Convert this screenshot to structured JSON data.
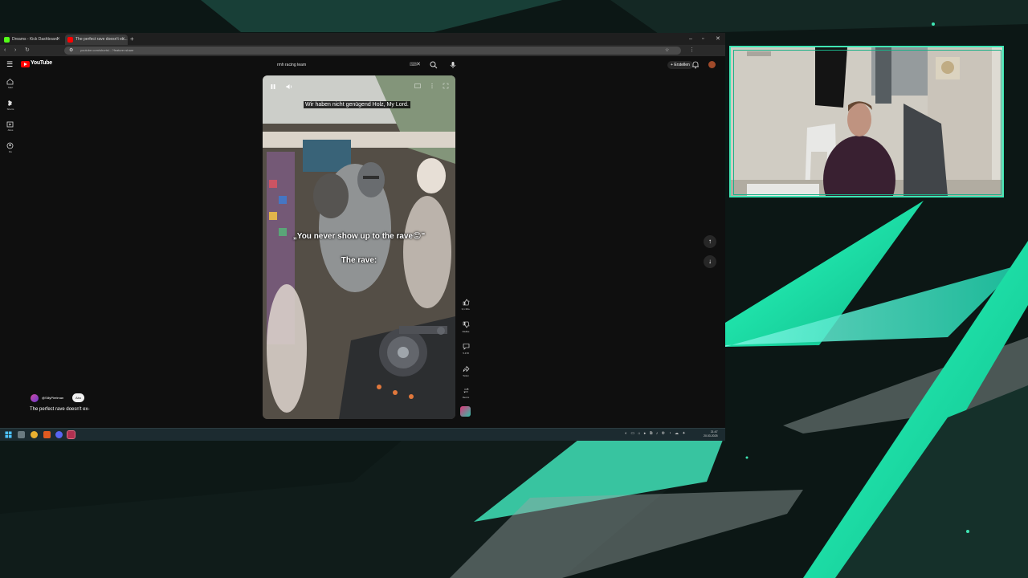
{
  "browser": {
    "tabs": [
      {
        "title": "Dreams - Kick Dashboard",
        "active": false,
        "icon_color": "#53fc18"
      },
      {
        "title": "The perfect rave doesn't ex...",
        "active": true,
        "icon_color": "#ff0000"
      }
    ],
    "new_tab_icon": "plus-icon",
    "url": "youtube.com/shorts/...?feature=share"
  },
  "youtube": {
    "logo_text": "YouTube",
    "search_query": "rmh racing team",
    "create_label": "Erstellen",
    "sidebar": [
      {
        "label": "Start",
        "icon": "home-icon"
      },
      {
        "label": "Shorts",
        "icon": "shorts-icon"
      },
      {
        "label": "Abos",
        "icon": "subscriptions-icon"
      },
      {
        "label": "Du",
        "icon": "you-icon"
      }
    ]
  },
  "short": {
    "caption_top": "Wir haben nicht genügend Holz, My Lord.",
    "overlay_line1": "„You never show up to the rave😡\"",
    "overlay_line2": "The rave:",
    "channel": "@SillyPirelman",
    "subscribe_label": "Abo",
    "title": "The perfect rave doesn't ex-",
    "actions": [
      {
        "icon": "thumbs-up-icon",
        "label": "3,1 Mio."
      },
      {
        "icon": "thumbs-down-icon",
        "label": "Dislike"
      },
      {
        "icon": "comment-icon",
        "label": "5.478"
      },
      {
        "icon": "share-icon",
        "label": "Teilen"
      },
      {
        "icon": "remix-icon",
        "label": "Remix"
      }
    ]
  },
  "taskbar": {
    "clock_time": "21:47",
    "clock_date": "20.03.2025"
  },
  "colors": {
    "overlay_accent": "#3fe6b4",
    "youtube_red": "#ff0000",
    "yt_bg": "#0f0f0f"
  }
}
